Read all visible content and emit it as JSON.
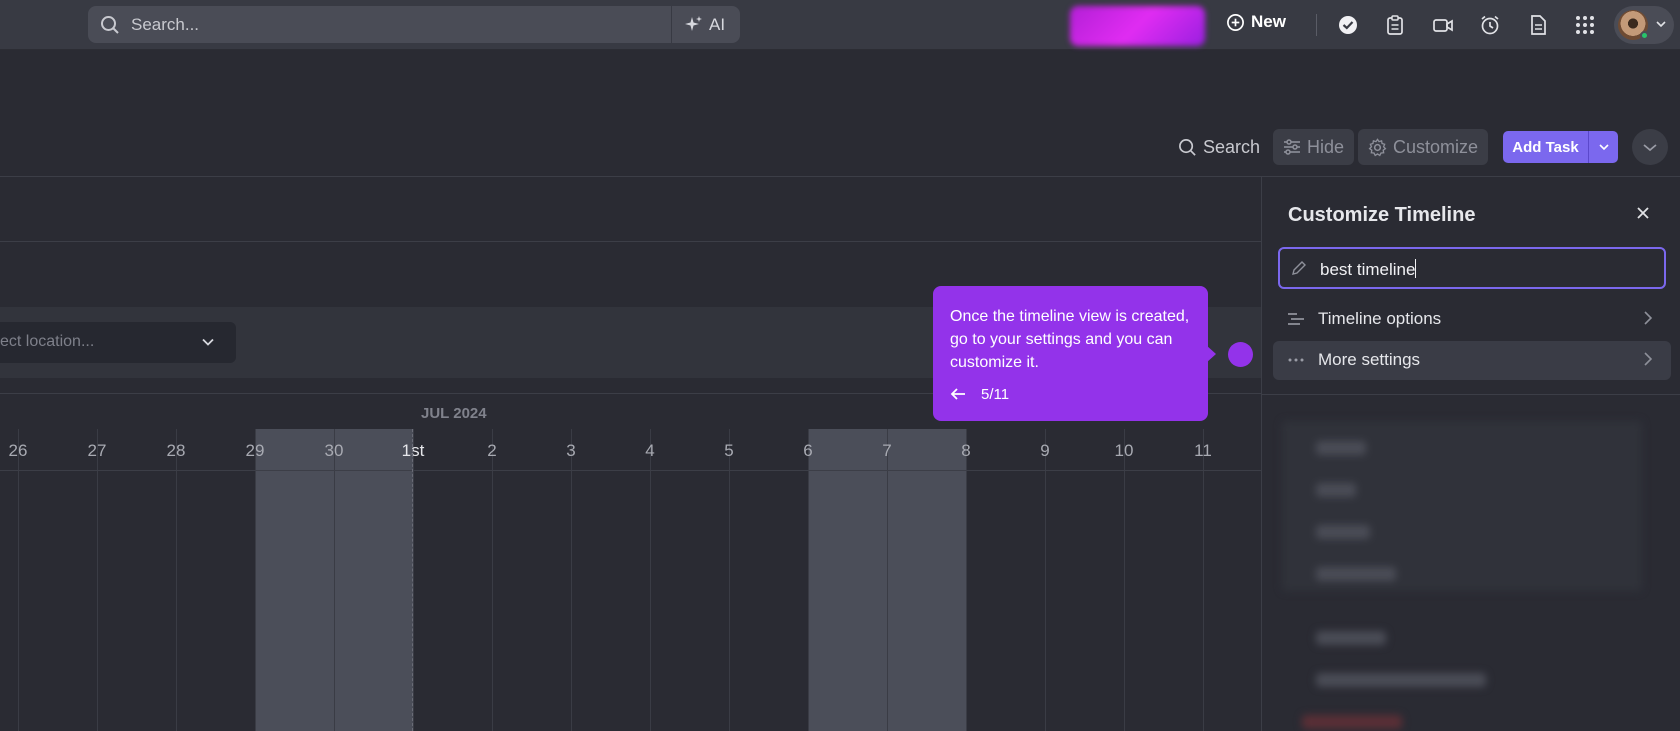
{
  "topbar": {
    "search_placeholder": "Search...",
    "ai_label": "AI",
    "new_label": "New",
    "icons": [
      "check-circle-icon",
      "clipboard-icon",
      "video-icon",
      "alarm-clock-icon",
      "document-icon",
      "apps-grid-icon"
    ]
  },
  "toolbar": {
    "search_label": "Search",
    "hide_label": "Hide",
    "customize_label": "Customize",
    "add_task_label": "Add Task"
  },
  "filter": {
    "location_placeholder": "ect location..."
  },
  "timeline": {
    "month_label": "JUL 2024",
    "days": [
      {
        "label": "26",
        "weekend": false
      },
      {
        "label": "27",
        "weekend": false
      },
      {
        "label": "28",
        "weekend": false
      },
      {
        "label": "29",
        "weekend": true
      },
      {
        "label": "30",
        "weekend": true
      },
      {
        "label": "1st",
        "weekend": false
      },
      {
        "label": "2",
        "weekend": false
      },
      {
        "label": "3",
        "weekend": false
      },
      {
        "label": "4",
        "weekend": false
      },
      {
        "label": "5",
        "weekend": false
      },
      {
        "label": "6",
        "weekend": true
      },
      {
        "label": "7",
        "weekend": true
      },
      {
        "label": "8",
        "weekend": false
      },
      {
        "label": "9",
        "weekend": false
      },
      {
        "label": "10",
        "weekend": false
      },
      {
        "label": "11",
        "weekend": false
      }
    ]
  },
  "tooltip": {
    "text": "Once the timeline view is created, go to your settings and you can customize it.",
    "step": "5/11"
  },
  "panel": {
    "title": "Customize Timeline",
    "name_value": "best timeline",
    "rows": [
      {
        "label": "Timeline options",
        "icon": "sliders-icon"
      },
      {
        "label": "More settings",
        "icon": "more-dots-icon"
      }
    ]
  },
  "colors": {
    "accent": "#7b68ee",
    "tooltip": "#9333ea",
    "background": "#2a2b33"
  }
}
